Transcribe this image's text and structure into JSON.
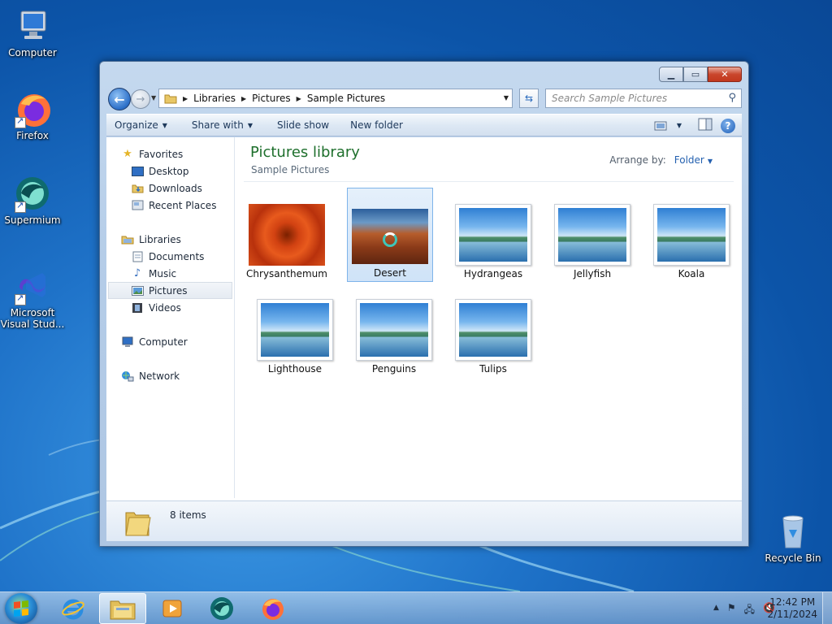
{
  "desktop": {
    "icons": [
      {
        "label": "Computer"
      },
      {
        "label": "Firefox"
      },
      {
        "label": "Supermium"
      },
      {
        "label": "Microsoft Visual Stud..."
      },
      {
        "label": "Recycle Bin"
      }
    ]
  },
  "window": {
    "address": {
      "crumbs": [
        "Libraries",
        "Pictures",
        "Sample Pictures"
      ]
    },
    "search": {
      "placeholder": "Search Sample Pictures"
    },
    "toolbar": {
      "organize": "Organize",
      "share_with": "Share with",
      "slide_show": "Slide show",
      "new_folder": "New folder"
    },
    "nav_pane": {
      "favorites": "Favorites",
      "desktop": "Desktop",
      "downloads": "Downloads",
      "recent_places": "Recent Places",
      "libraries": "Libraries",
      "documents": "Documents",
      "music": "Music",
      "pictures": "Pictures",
      "videos": "Videos",
      "computer": "Computer",
      "network": "Network"
    },
    "content": {
      "title": "Pictures library",
      "subtitle": "Sample Pictures",
      "arrange_label": "Arrange by:",
      "arrange_value": "Folder",
      "items": [
        {
          "name": "Chrysanthemum"
        },
        {
          "name": "Desert"
        },
        {
          "name": "Hydrangeas"
        },
        {
          "name": "Jellyfish"
        },
        {
          "name": "Koala"
        },
        {
          "name": "Lighthouse"
        },
        {
          "name": "Penguins"
        },
        {
          "name": "Tulips"
        }
      ]
    },
    "details": {
      "count": "8 items"
    }
  },
  "taskbar": {
    "clock_time": "12:42 PM",
    "clock_date": "2/11/2024"
  },
  "colors": {
    "library_title": "#1e6f2c",
    "selection_border": "#7eb4ea",
    "close_button": "#c9462c"
  }
}
